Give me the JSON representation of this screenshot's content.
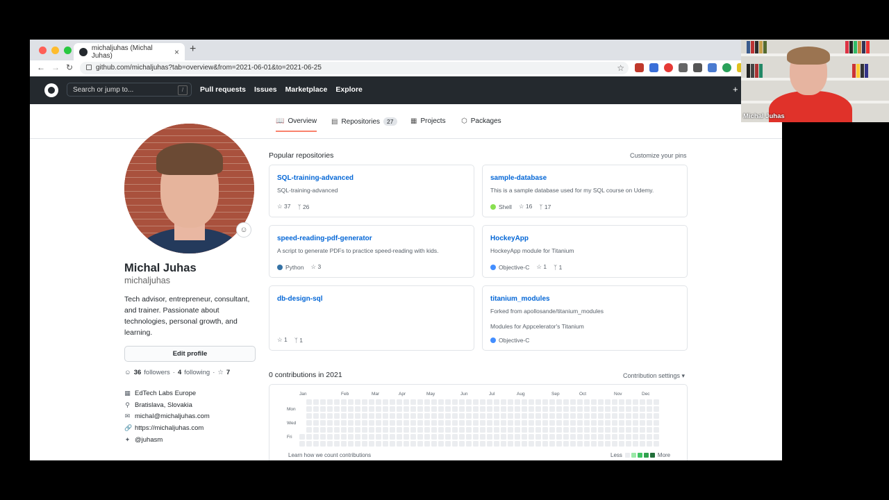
{
  "browser": {
    "tab_title": "michaljuhas (Michal Juhas)",
    "tab_close": "×",
    "new_tab": "+",
    "url": "github.com/michaljuhas?tab=overview&from=2021-06-01&to=2021-06-25"
  },
  "github_header": {
    "search_placeholder": "Search or jump to...",
    "search_key": "/",
    "nav": [
      "Pull requests",
      "Issues",
      "Marketplace",
      "Explore"
    ],
    "plus": "+"
  },
  "profile_tabs": [
    {
      "label": "Overview",
      "active": true
    },
    {
      "label": "Repositories",
      "count": "27"
    },
    {
      "label": "Projects"
    },
    {
      "label": "Packages"
    }
  ],
  "profile": {
    "name": "Michal Juhas",
    "login": "michaljuhas",
    "bio": "Tech advisor, entrepreneur, consultant, and trainer. Passionate about technologies, personal growth, and learning.",
    "edit_label": "Edit profile",
    "followers_count": "36",
    "followers_label": "followers",
    "following_count": "4",
    "following_label": "following",
    "stars_count": "7",
    "company": "EdTech Labs Europe",
    "location": "Bratislava, Slovakia",
    "email": "michal@michaljuhas.com",
    "website": "https://michaljuhas.com",
    "twitter": "@juhasm"
  },
  "popular": {
    "title": "Popular repositories",
    "customize": "Customize your pins",
    "repos": [
      {
        "name": "SQL-training-advanced",
        "desc": "SQL-training-advanced",
        "desc2": "",
        "lang": "",
        "lang_color": "",
        "stars": "37",
        "forks": "26"
      },
      {
        "name": "sample-database",
        "desc": "This is a sample database used for my SQL course on Udemy.",
        "desc2": "",
        "lang": "Shell",
        "lang_color": "#89e051",
        "stars": "16",
        "forks": "17"
      },
      {
        "name": "speed-reading-pdf-generator",
        "desc": "A script to generate PDFs to practice speed-reading with kids.",
        "desc2": "",
        "lang": "Python",
        "lang_color": "#3572A5",
        "stars": "3",
        "forks": ""
      },
      {
        "name": "HockeyApp",
        "desc": "HockeyApp module for Titanium",
        "desc2": "",
        "lang": "Objective-C",
        "lang_color": "#438eff",
        "stars": "1",
        "forks": "1"
      },
      {
        "name": "db-design-sql",
        "desc": "",
        "desc2": "",
        "lang": "",
        "lang_color": "",
        "stars": "1",
        "forks": "1"
      },
      {
        "name": "titanium_modules",
        "desc": "Forked from apollosande/titanium_modules",
        "desc2": "Modules for Appcelerator's Titanium",
        "lang": "Objective-C",
        "lang_color": "#438eff",
        "stars": "",
        "forks": ""
      }
    ]
  },
  "contributions": {
    "title": "0 contributions in 2021",
    "settings": "Contribution settings ▾",
    "months": [
      "Jan",
      "Feb",
      "Mar",
      "Apr",
      "May",
      "Jun",
      "Jul",
      "Aug",
      "Sep",
      "Oct",
      "Nov",
      "Dec"
    ],
    "days": [
      "Mon",
      "Wed",
      "Fri"
    ],
    "learn": "Learn how we count contributions",
    "less": "Less",
    "more": "More",
    "legend_colors": [
      "#ebedf0",
      "#9be9a8",
      "#40c463",
      "#30a14e",
      "#216e39"
    ]
  },
  "webcam": {
    "name": "Michal Juhas"
  },
  "colors": {
    "header_bg": "#24292e",
    "link": "#0366d6",
    "tab_underline": "#f9826c"
  }
}
